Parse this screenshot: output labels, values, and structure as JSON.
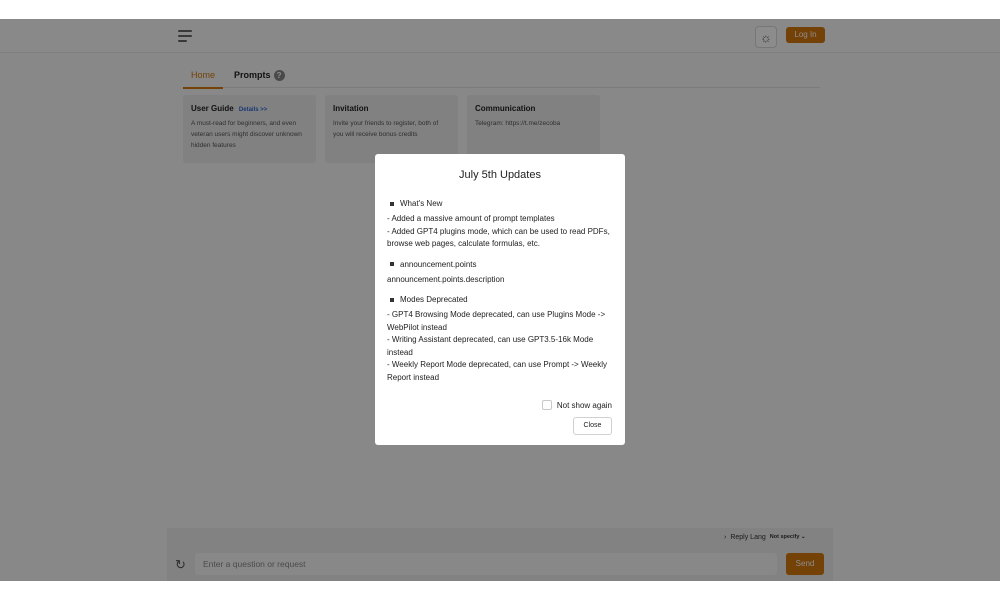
{
  "header": {
    "menu_icon": "hamburger-icon",
    "theme_icon": "sun-icon",
    "login_label": "Log In"
  },
  "tabs": [
    {
      "label": "Home",
      "active": true
    },
    {
      "label": "Prompts",
      "help_icon": "?"
    }
  ],
  "cards": [
    {
      "title": "User Guide",
      "link": "Details >>",
      "desc": "A must-read for beginners, and even veteran users might discover unknown hidden features"
    },
    {
      "title": "Invitation",
      "desc": "Invite your friends to register, both of you will receive bonus credits"
    },
    {
      "title": "Communication",
      "desc": "Telegram: https://t.me/zecoba"
    }
  ],
  "modal": {
    "title": "July 5th Updates",
    "sections": [
      {
        "heading": "What's New",
        "lines": [
          "- Added a massive amount of prompt templates",
          "- Added GPT4 plugins mode, which can be used to read PDFs, browse web pages, calculate formulas, etc."
        ]
      },
      {
        "heading": "announcement.points",
        "lines": [
          "announcement.points.description"
        ]
      },
      {
        "heading": "Modes Deprecated",
        "lines": [
          "- GPT4 Browsing Mode deprecated, can use Plugins Mode -> WebPilot instead",
          "- Writing Assistant deprecated, can use GPT3.5-16k Mode instead",
          "- Weekly Report Mode deprecated, can use Prompt -> Weekly Report instead"
        ]
      }
    ],
    "not_show_again": "Not show again",
    "close_label": "Close"
  },
  "footer": {
    "reply_lang_label": "Reply Lang",
    "reply_lang_value": "Not specify",
    "input_placeholder": "Enter a question or request",
    "send_label": "Send"
  },
  "colors": {
    "accent": "#d4770c",
    "link": "#2f6bd6"
  }
}
